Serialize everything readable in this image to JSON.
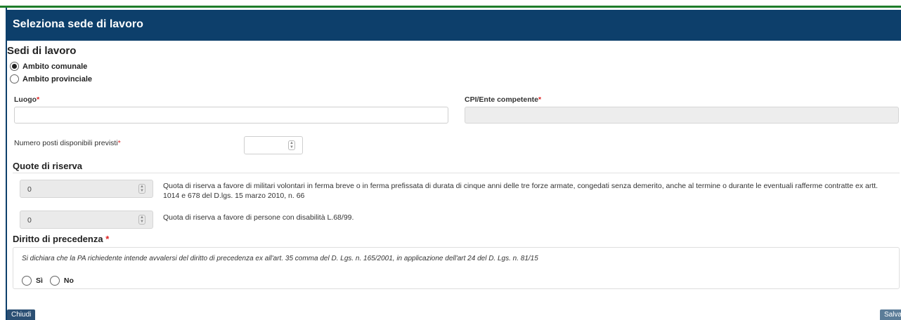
{
  "header": {
    "title": "Seleziona sede di lavoro"
  },
  "sedi": {
    "title": "Sedi di lavoro",
    "options": [
      {
        "label": "Ambito comunale",
        "checked": true
      },
      {
        "label": "Ambito provinciale",
        "checked": false
      }
    ]
  },
  "fields": {
    "luogo_label": "Luogo",
    "cpi_label": "CPI/Ente competente",
    "required_mark": "*",
    "luogo_value": "",
    "cpi_value": ""
  },
  "posti": {
    "label": "Numero posti disponibili previsti",
    "required_mark": "*",
    "value": ""
  },
  "quote": {
    "title": "Quote di riserva",
    "items": [
      {
        "value": "0",
        "text": "Quota di riserva a favore di militari volontari in ferma breve o in ferma prefissata di durata di cinque anni delle tre forze armate, congedati senza demerito, anche al termine o durante le eventuali rafferme contratte ex artt. 1014 e 678 del D.lgs. 15 marzo 2010, n. 66"
      },
      {
        "value": "0",
        "text": "Quota di riserva a favore di persone con disabilità L.68/99."
      }
    ]
  },
  "precedenza": {
    "title": "Diritto di precedenza",
    "required_mark": "*",
    "text": "Si dichiara che la PA richiedente intende avvalersi del diritto di precedenza ex all'art. 35 comma del D. Lgs. n. 165/2001, in applicazione dell'art 24 del D. Lgs. n. 81/15",
    "yes_label": "Sì",
    "no_label": "No"
  },
  "buttons": {
    "close_label": "Chiudi",
    "save_label": "Salva"
  },
  "colors": {
    "header_bg": "#0d3f6b",
    "top_line": "#1e7d2a",
    "required": "#dd2222"
  }
}
